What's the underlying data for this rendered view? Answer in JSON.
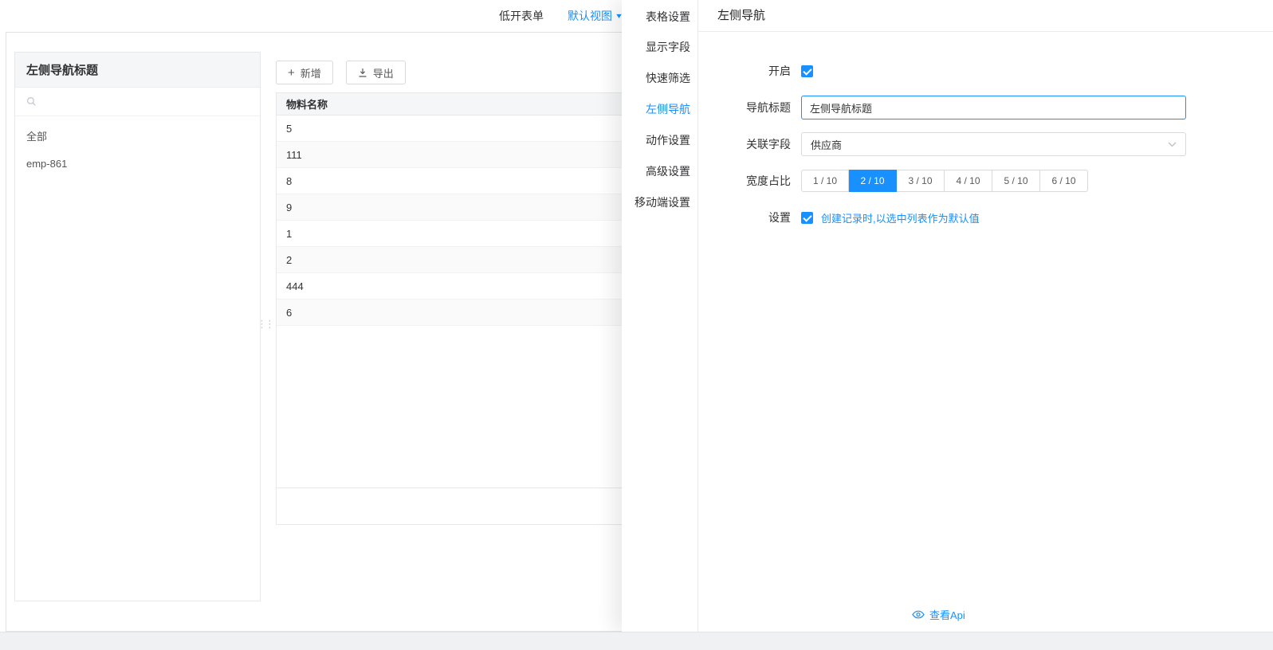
{
  "topbar": {
    "tabs": [
      {
        "label": "低开表单"
      },
      {
        "label": "默认视图"
      }
    ]
  },
  "left_panel": {
    "title": "左侧导航标题",
    "items": [
      "全部",
      "emp-861"
    ]
  },
  "toolbar": {
    "add": "新增",
    "export": "导出"
  },
  "table": {
    "header": "物料名称",
    "rows": [
      "5",
      "111",
      "8",
      "9",
      "1",
      "2",
      "444",
      "6"
    ]
  },
  "drawer": {
    "menu_title": "表格设置",
    "menu": [
      "显示字段",
      "快速筛选",
      "左侧导航",
      "动作设置",
      "高级设置",
      "移动端设置"
    ],
    "active_menu": "左侧导航",
    "title": "左侧导航",
    "form": {
      "enable_label": "开启",
      "enable_checked": true,
      "title_label": "导航标题",
      "title_value": "左侧导航标题",
      "field_label": "关联字段",
      "field_value": "供应商",
      "width_label": "宽度占比",
      "width_options": [
        "1 / 10",
        "2 / 10",
        "3 / 10",
        "4 / 10",
        "5 / 10",
        "6 / 10"
      ],
      "width_selected": "2 / 10",
      "settings_label": "设置",
      "settings_checked": true,
      "settings_link": "创建记录时,以选中列表作为默认值"
    },
    "api_link": "查看Api"
  },
  "icons": {
    "plus": "+",
    "caret_down": "▾",
    "drag_handle": "⋮⋮"
  },
  "colors": {
    "accent": "#1890ff"
  }
}
